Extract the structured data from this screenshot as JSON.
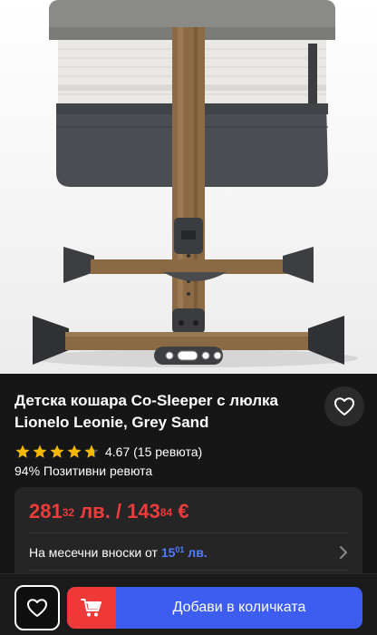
{
  "product": {
    "title": "Детска кошара Co-Sleeper с люлка Lionelo Leonie, Grey Sand",
    "rating_value": 4.67,
    "rating_text": "4.67 (15 ревюта)",
    "positive_reviews": "94% Позитивни ревюта"
  },
  "price": {
    "bgn_main": "281",
    "bgn_cents": "32",
    "bgn_unit": " лв. / ",
    "eur_main": "143",
    "eur_cents": "84",
    "eur_unit": " €"
  },
  "installment": {
    "prefix": "На месечни вноски от ",
    "amount_main": "15",
    "amount_cents": "01",
    "amount_unit": " лв."
  },
  "actions": {
    "add_to_cart": "Добави в количката"
  },
  "icons": {
    "favorite": "heart-icon",
    "wishlist": "heart-icon",
    "cart": "cart-icon",
    "chevron": "chevron-right-icon",
    "stars": "star-icon"
  },
  "colors": {
    "price_red": "#ee3b3b",
    "installment_blue": "#4f7dff",
    "cart_blue": "#3d5cf0",
    "cart_red": "#ef3838",
    "star_gold": "#f5b800"
  }
}
